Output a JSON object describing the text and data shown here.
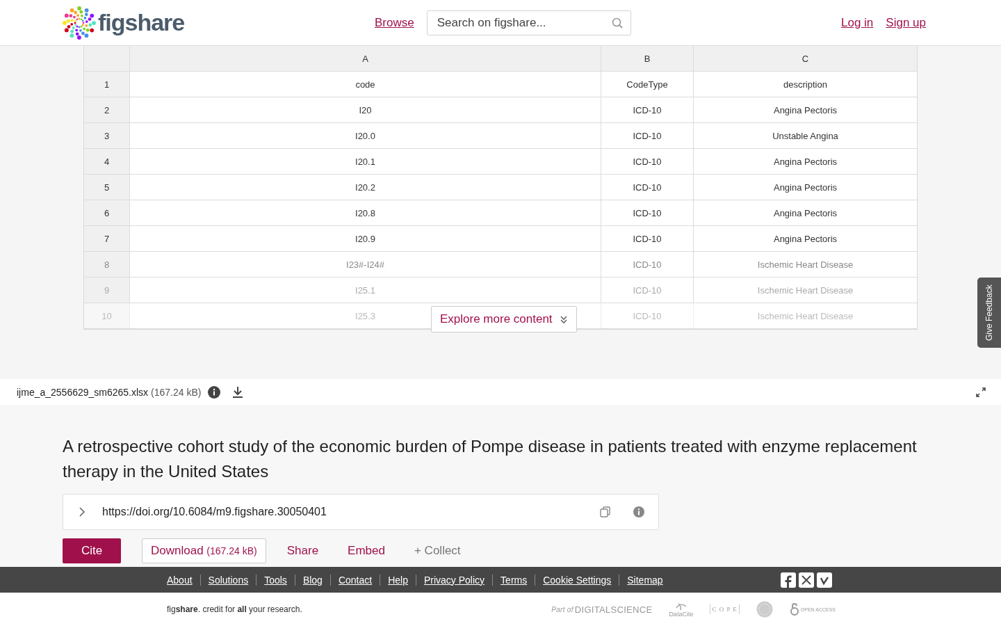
{
  "header": {
    "logo_text": "figshare",
    "nav": [
      "Browse"
    ],
    "search": {
      "placeholder": "Search on figshare..."
    },
    "auth_links": [
      "Log in",
      "Sign up"
    ]
  },
  "preview": {
    "columns": [
      "A",
      "B",
      "C"
    ],
    "rows": [
      {
        "number": "1",
        "cells": [
          "code",
          "CodeType",
          "description"
        ]
      },
      {
        "number": "2",
        "cells": [
          "I20",
          "ICD-10",
          "Angina Pectoris"
        ]
      },
      {
        "number": "3",
        "cells": [
          "I20.0",
          "ICD-10",
          "Unstable Angina"
        ]
      },
      {
        "number": "4",
        "cells": [
          "I20.1",
          "ICD-10",
          "Angina Pectoris"
        ]
      },
      {
        "number": "5",
        "cells": [
          "I20.2",
          "ICD-10",
          "Angina Pectoris"
        ]
      },
      {
        "number": "6",
        "cells": [
          "I20.8",
          "ICD-10",
          "Angina Pectoris"
        ]
      },
      {
        "number": "7",
        "cells": [
          "I20.9",
          "ICD-10",
          "Angina Pectoris"
        ]
      },
      {
        "number": "8",
        "cells": [
          "I23#-I24#",
          "ICD-10",
          "Ischemic Heart Disease"
        ]
      },
      {
        "number": "9",
        "cells": [
          "I25.1",
          "ICD-10",
          "Ischemic Heart Disease"
        ]
      },
      {
        "number": "10",
        "cells": [
          "I25.3",
          "ICD-10",
          "Ischemic Heart Disease"
        ]
      }
    ],
    "explore_button": "Explore more content",
    "feedback_tab": "Give Feedback"
  },
  "file_bar": {
    "filename": "ijme_a_2556629_sm6265.xlsx",
    "size": "(167.24 kB)"
  },
  "article": {
    "title": "A retrospective cohort study of the economic burden of Pompe disease in patients treated with enzyme replacement therapy in the United States",
    "doi": "https://doi.org/10.6084/m9.figshare.30050401",
    "actions": [
      {
        "kind": "primary",
        "label": "Cite"
      },
      {
        "kind": "outline",
        "label": "Download",
        "extra": "(167.24 kB)"
      },
      {
        "kind": "link",
        "label": "Share"
      },
      {
        "kind": "link",
        "label": "Embed"
      },
      {
        "kind": "muted",
        "label": "+ Collect"
      }
    ]
  },
  "footer": {
    "links": [
      "About",
      "Solutions",
      "Tools",
      "Blog",
      "Contact",
      "Help",
      "Privacy Policy",
      "Terms",
      "Cookie Settings",
      "Sitemap"
    ],
    "tagline": "fig**share**. credit for **all** your research.",
    "partners": [
      {
        "kind": "ds",
        "label": "Part of",
        "brand": "DIGITALSCIENCE"
      },
      {
        "kind": "datacite",
        "label": "DataCite"
      },
      {
        "kind": "cope",
        "label": "C O P E"
      },
      {
        "kind": "seal"
      },
      {
        "kind": "oa",
        "label": "OPEN ACCESS"
      }
    ]
  }
}
